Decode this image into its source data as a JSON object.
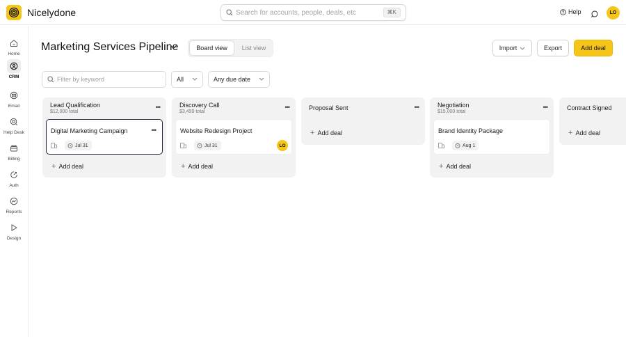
{
  "app": {
    "brand": "Nicelydone",
    "search_placeholder": "Search for accounts, people, deals, etc",
    "search_shortcut": "⌘K",
    "help_label": "Help",
    "user_initials": "LO",
    "accent_color": "#f5c518"
  },
  "sidebar": {
    "items": [
      {
        "label": "Home",
        "icon": "home-icon"
      },
      {
        "label": "CRM",
        "icon": "crm-icon",
        "active": true
      },
      {
        "label": "Email",
        "icon": "email-icon"
      },
      {
        "label": "Help Desk",
        "icon": "help-desk-icon"
      },
      {
        "label": "Billing",
        "icon": "billing-icon"
      },
      {
        "label": "Auth",
        "icon": "auth-icon"
      },
      {
        "label": "Reports",
        "icon": "reports-icon"
      },
      {
        "label": "Design",
        "icon": "design-icon"
      }
    ]
  },
  "header": {
    "title": "Marketing Services Pipeline",
    "views": [
      "Board view",
      "List view"
    ],
    "active_view": "Board view",
    "import_label": "Import",
    "export_label": "Export",
    "add_deal_label": "Add deal"
  },
  "filters": {
    "keyword_placeholder": "Filter by keyword",
    "owner_value": "All",
    "due_value": "Any due date"
  },
  "board": {
    "columns": [
      {
        "title": "Lead Qualification",
        "total": "$12,000 total",
        "cards": [
          {
            "title": "Digital Marketing Campaign",
            "date": "Jul 31"
          }
        ],
        "add_label": "Add deal"
      },
      {
        "title": "Discovery Call",
        "total": "$3,499 total",
        "cards": [
          {
            "title": "Website Redesign Project",
            "date": "Jul 31",
            "assignee": "LO"
          }
        ],
        "add_label": "Add deal"
      },
      {
        "title": "Proposal Sent",
        "total": "",
        "cards": [],
        "add_label": "Add deal"
      },
      {
        "title": "Negotiation",
        "total": "$15,000 total",
        "cards": [
          {
            "title": "Brand Identity Package",
            "date": "Aug 1"
          }
        ],
        "add_label": "Add deal"
      },
      {
        "title": "Contract Signed",
        "total": "",
        "cards": [],
        "add_label": "Add deal"
      }
    ]
  }
}
